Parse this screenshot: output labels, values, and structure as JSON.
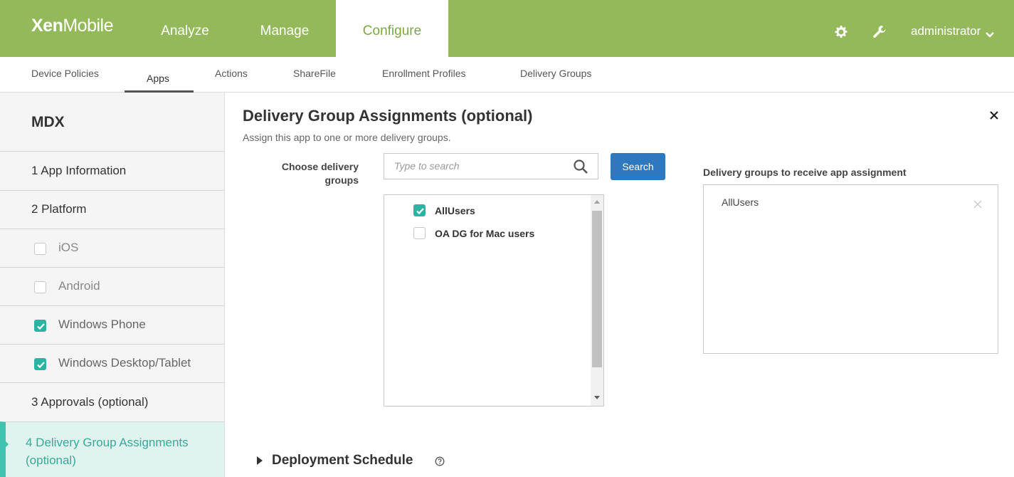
{
  "app": {
    "logo_bold": "Xen",
    "logo_light": "Mobile"
  },
  "topnav": {
    "analyze": "Analyze",
    "manage": "Manage",
    "configure": "Configure",
    "user": "administrator"
  },
  "subnav": {
    "items": [
      "Device Policies",
      "Apps",
      "Actions",
      "ShareFile",
      "Enrollment Profiles",
      "Delivery Groups"
    ],
    "active": "Apps"
  },
  "sidebar": {
    "title": "MDX",
    "steps": {
      "app_info": "1  App Information",
      "platform": "2  Platform",
      "ios": "iOS",
      "android": "Android",
      "windows_phone": "Windows Phone",
      "windows_desktop": "Windows Desktop/Tablet",
      "approvals": "3  Approvals (optional)",
      "delivery": "4  Delivery Group Assignments (optional)"
    }
  },
  "main": {
    "title": "Delivery Group Assignments (optional)",
    "subtitle": "Assign this app to one or more delivery groups.",
    "choose_label": "Choose delivery groups",
    "search_placeholder": "Type to search",
    "search_button": "Search",
    "groups": {
      "all_users": "AllUsers",
      "oa_dg": "OA DG for Mac users"
    },
    "receive_label": "Delivery groups to receive app assignment",
    "receive_item": "AllUsers",
    "deployment_schedule": "Deployment Schedule"
  },
  "colors": {
    "brand_green": "#93b95a",
    "accent_teal": "#2bb3a3",
    "button_blue": "#2e78c0"
  },
  "icons": [
    "gear-icon",
    "wrench-icon",
    "chevron-down-icon",
    "close-icon",
    "search-icon",
    "remove-icon",
    "help-icon"
  ]
}
